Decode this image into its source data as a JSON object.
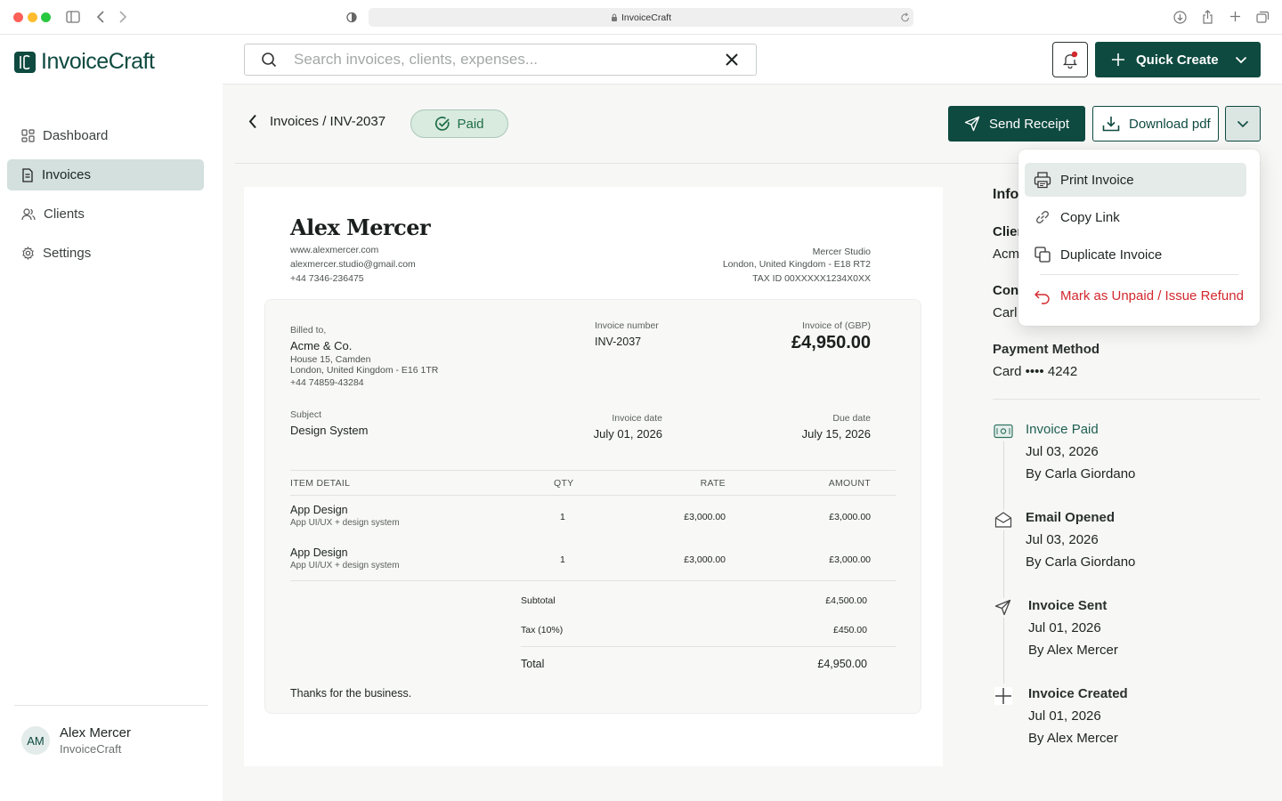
{
  "browser": {
    "url": "InvoiceCraft"
  },
  "app": {
    "name": "InvoiceCraft"
  },
  "sidebar": {
    "items": [
      {
        "label": "Dashboard",
        "icon": "dashboard-icon"
      },
      {
        "label": "Invoices",
        "icon": "document-icon",
        "active": true
      },
      {
        "label": "Clients",
        "icon": "users-icon"
      },
      {
        "label": "Settings",
        "icon": "gear-icon"
      }
    ],
    "user": {
      "initials": "AM",
      "name": "Alex Mercer",
      "org": "InvoiceCraft"
    }
  },
  "header": {
    "search_placeholder": "Search invoices, clients, expenses...",
    "quick_create": "Quick Create"
  },
  "page": {
    "breadcrumb": "Invoices / INV-2037",
    "status": "Paid",
    "send_receipt": "Send Receipt",
    "download_pdf": "Download pdf"
  },
  "dropdown": {
    "items": [
      {
        "label": "Print Invoice",
        "icon": "printer-icon"
      },
      {
        "label": "Copy Link",
        "icon": "link-icon"
      },
      {
        "label": "Duplicate Invoice",
        "icon": "duplicate-icon"
      },
      {
        "label": "Mark as Unpaid / Issue Refund",
        "icon": "undo-icon",
        "danger": true
      }
    ]
  },
  "invoice": {
    "sender_name": "Alex Mercer",
    "sender_web": "www.alexmercer.com",
    "sender_email": "alexmercer.studio@gmail.com",
    "sender_phone": "+44 7346-236475",
    "studio_name": "Mercer Studio",
    "studio_address": "London, United Kingdom - E18 RT2",
    "studio_tax": "TAX ID 00XXXXX1234X0XX",
    "billed_label": "Billed to,",
    "client_name": "Acme & Co.",
    "client_addr1": "House 15, Camden",
    "client_addr2": "London, United Kingdom - E16 1TR",
    "client_phone": "+44 74859-43284",
    "number_label": "Invoice number",
    "number": "INV-2037",
    "total_label": "Invoice of (GBP)",
    "total_big": "£4,950.00",
    "subject_label": "Subject",
    "subject": "Design System",
    "date_label": "Invoice date",
    "date": "July 01, 2026",
    "due_label": "Due date",
    "due": "July 15, 2026",
    "columns": [
      "ITEM DETAIL",
      "QTY",
      "RATE",
      "AMOUNT"
    ],
    "items": [
      {
        "name": "App Design",
        "desc": "App UI/UX + design system",
        "qty": "1",
        "rate": "£3,000.00",
        "amount": "£3,000.00"
      },
      {
        "name": "App Design",
        "desc": "App UI/UX + design system",
        "qty": "1",
        "rate": "£3,000.00",
        "amount": "£3,000.00"
      }
    ],
    "subtotal_label": "Subtotal",
    "subtotal": "£4,500.00",
    "tax_label": "Tax (10%)",
    "tax": "£450.00",
    "total_label2": "Total",
    "total": "£4,950.00",
    "thanks": "Thanks for the business."
  },
  "info": {
    "title": "Info",
    "client_label": "Clien",
    "client_value": "Acm",
    "contact_label": "Con",
    "contact_value": "Carl",
    "payment_label": "Payment Method",
    "payment_value": "Card •••• 4242",
    "timeline": [
      {
        "title": "Invoice Paid",
        "date": "Jul 03, 2026",
        "by": "By Carla Giordano",
        "icon": "money-icon",
        "accent": true
      },
      {
        "title": "Email Opened",
        "date": "Jul 03, 2026",
        "by": "By Carla Giordano",
        "icon": "envelope-open-icon"
      },
      {
        "title": "Invoice Sent",
        "date": "Jul 01, 2026",
        "by": "By Alex Mercer",
        "icon": "send-icon"
      },
      {
        "title": "Invoice Created",
        "date": "Jul 01, 2026",
        "by": "By Alex Mercer",
        "icon": "plus-icon"
      }
    ]
  },
  "colors": {
    "brand": "#0e4a40",
    "paid_bg": "#d9eadf",
    "danger": "#d2282e"
  }
}
